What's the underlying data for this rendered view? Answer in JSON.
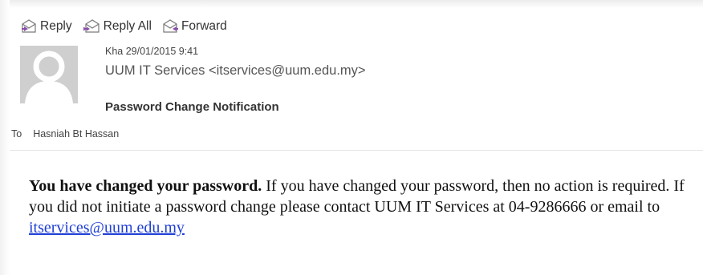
{
  "toolbar": {
    "reply_label": "Reply",
    "reply_all_label": "Reply All",
    "forward_label": "Forward"
  },
  "header": {
    "date": "Kha 29/01/2015 9:41",
    "sender": "UUM IT Services <itservices@uum.edu.my>",
    "subject": "Password Change Notification",
    "to_label": "To",
    "recipient": "Hasniah Bt Hassan"
  },
  "body": {
    "bold_lead": "You have changed your password.",
    "text": " If you have changed your password, then no action is required. If you did not initiate a password change please contact UUM IT Services at 04-9286666 or email to ",
    "link": "itservices@uum.edu.my"
  },
  "colors": {
    "icon_accent": "#8a4fa8",
    "link": "#1f3fd6",
    "avatar_bg": "#cfcfcf",
    "avatar_fg": "#ffffff"
  },
  "icons": [
    "reply-icon",
    "reply-all-icon",
    "forward-icon",
    "default-avatar-icon"
  ]
}
